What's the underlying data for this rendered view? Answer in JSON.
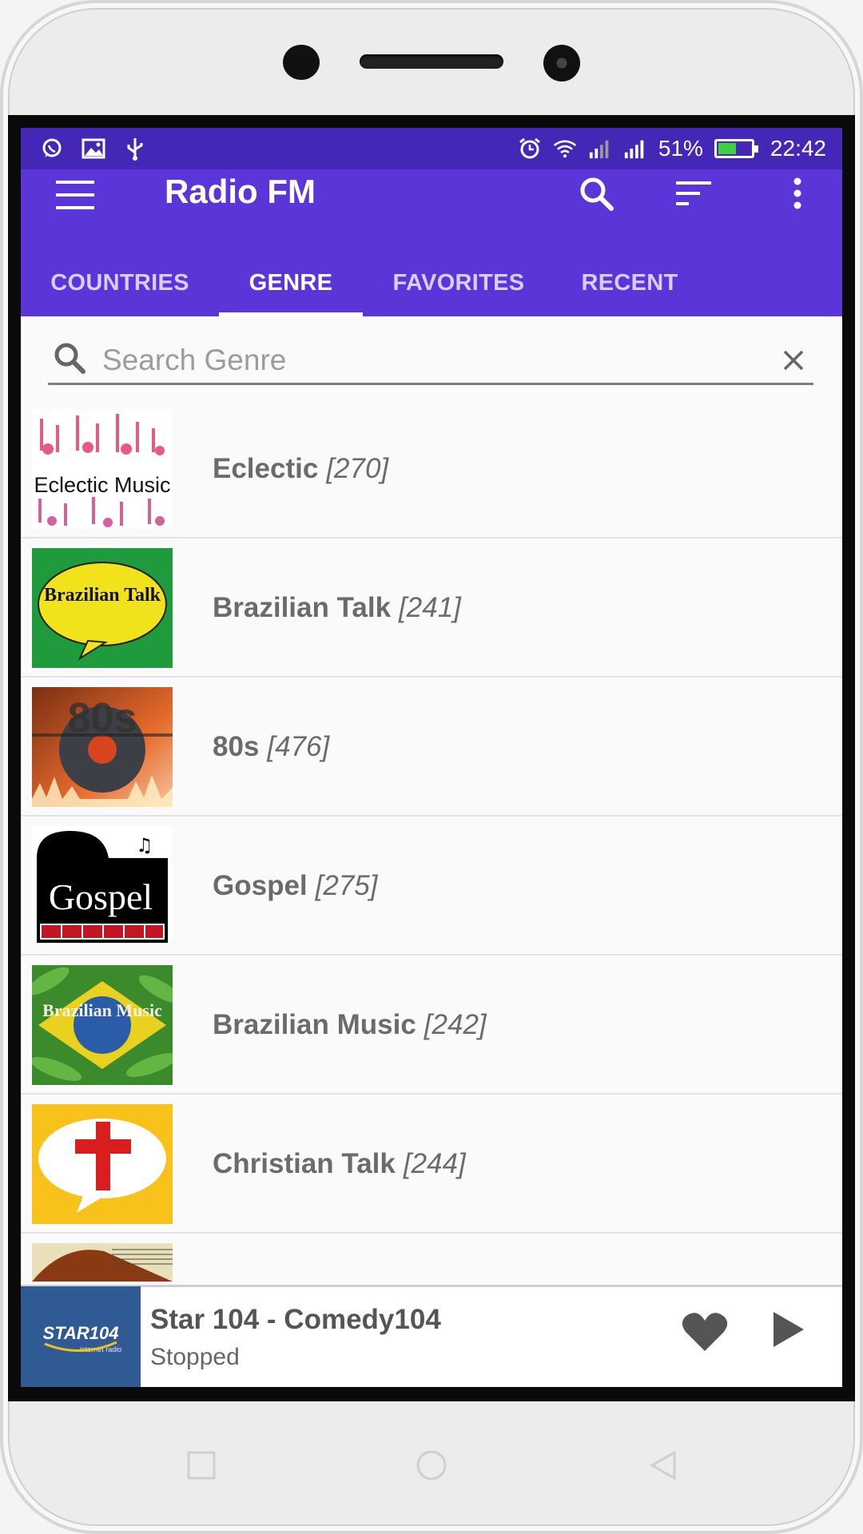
{
  "status_bar": {
    "left_icons": [
      "whatsapp-icon",
      "gallery-icon",
      "usb-icon"
    ],
    "right_icons": [
      "alarm-icon",
      "wifi-icon",
      "signal-icon",
      "signal-icon"
    ],
    "battery_percent": "51%",
    "battery_level": 0.51,
    "battery_color": "#3ed33e",
    "time": "22:42"
  },
  "app_bar": {
    "title": "Radio FM",
    "color": "#5b35d8",
    "status_color": "#4427b6",
    "actions": [
      "search-icon",
      "sort-icon",
      "more-vert-icon"
    ]
  },
  "tabs": [
    {
      "label": "COUNTRIES",
      "active": false
    },
    {
      "label": "GENRE",
      "active": true
    },
    {
      "label": "FAVORITES",
      "active": false
    },
    {
      "label": "RECENT",
      "active": false
    }
  ],
  "search": {
    "placeholder": "Search Genre",
    "value": ""
  },
  "genres": [
    {
      "name": "Eclectic",
      "count": "[270]",
      "art_text": "Eclectic Music"
    },
    {
      "name": "Brazilian Talk",
      "count": "[241]",
      "art_text": "Brazilian Talk"
    },
    {
      "name": "80s",
      "count": "[476]",
      "art_text": "80s"
    },
    {
      "name": "Gospel",
      "count": "[275]",
      "art_text": "Gospel music"
    },
    {
      "name": "Brazilian Music",
      "count": "[242]",
      "art_text": "Brazilian Music"
    },
    {
      "name": "Christian Talk",
      "count": "[244]",
      "art_text": ""
    }
  ],
  "player": {
    "station": "Star 104 - Comedy104",
    "status": "Stopped",
    "logo_text": "STAR104",
    "logo_subtext": "internet radio"
  }
}
